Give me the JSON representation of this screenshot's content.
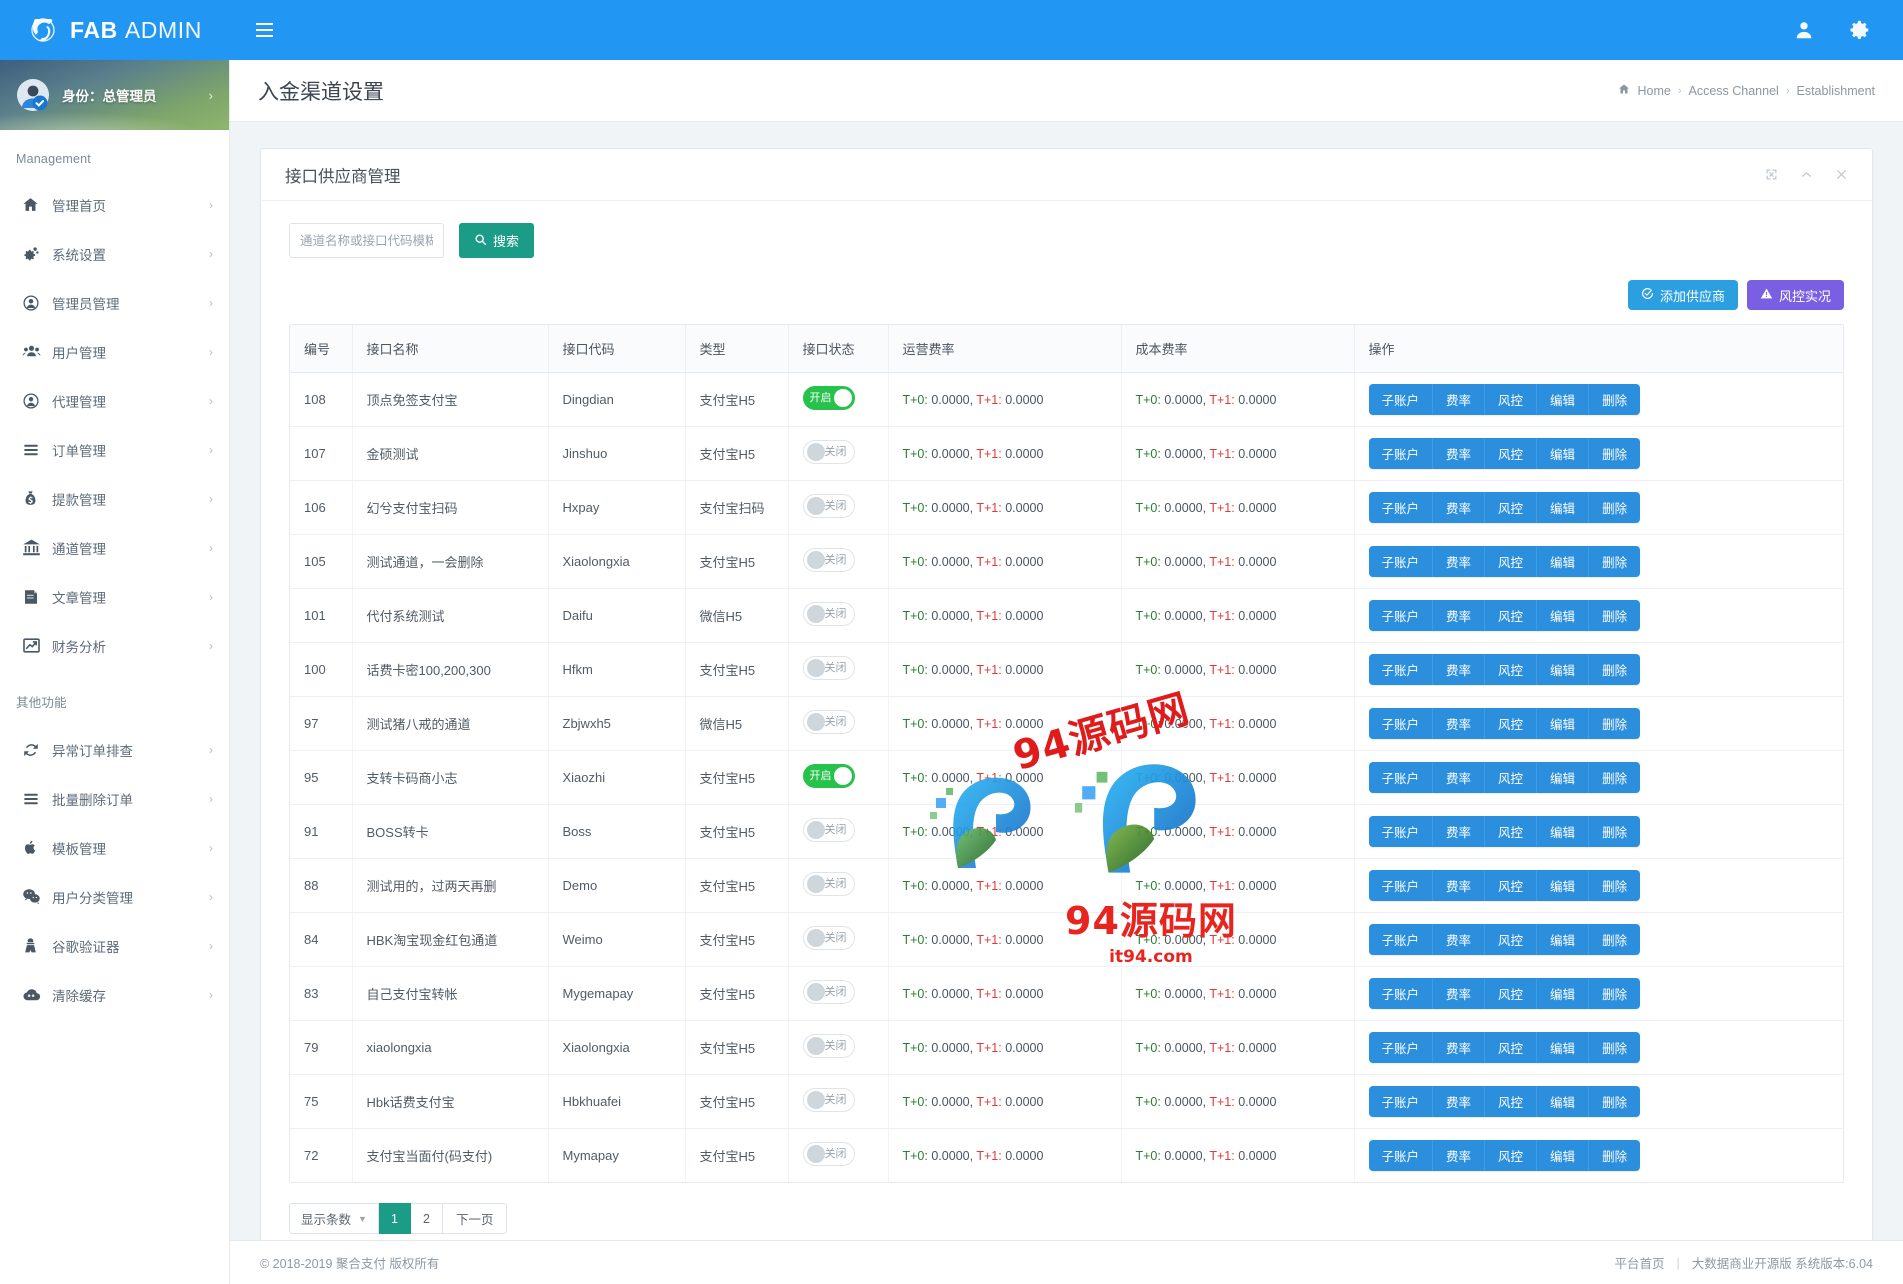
{
  "brand": {
    "name_bold": "FAB",
    "name_light": "ADMIN"
  },
  "topbar": {
    "menu_toggle": "menu-toggle",
    "user_icon": "user-icon",
    "settings_icon": "gear-icon"
  },
  "sidebar": {
    "profile": {
      "label": "身份：总管理员"
    },
    "section_management": "Management",
    "section_other": "其他功能",
    "items": [
      {
        "label": "管理首页",
        "icon": "home-icon"
      },
      {
        "label": "系统设置",
        "icon": "gears-icon"
      },
      {
        "label": "管理员管理",
        "icon": "user-circle-icon"
      },
      {
        "label": "用户管理",
        "icon": "users-icon"
      },
      {
        "label": "代理管理",
        "icon": "user-circle-o-icon"
      },
      {
        "label": "订单管理",
        "icon": "list-icon"
      },
      {
        "label": "提款管理",
        "icon": "money-bag-icon"
      },
      {
        "label": "通道管理",
        "icon": "bank-icon"
      },
      {
        "label": "文章管理",
        "icon": "book-icon"
      },
      {
        "label": "财务分析",
        "icon": "chart-line-icon"
      }
    ],
    "items_other": [
      {
        "label": "异常订单排查",
        "icon": "refresh-icon"
      },
      {
        "label": "批量删除订单",
        "icon": "list-icon"
      },
      {
        "label": "模板管理",
        "icon": "apple-icon"
      },
      {
        "label": "用户分类管理",
        "icon": "wechat-icon"
      },
      {
        "label": "谷歌验证器",
        "icon": "user-secret-icon"
      },
      {
        "label": "清除缓存",
        "icon": "cloud-icon"
      }
    ]
  },
  "page": {
    "title": "入金渠道设置",
    "breadcrumb": [
      {
        "label": "Home",
        "icon": "home-icon"
      },
      {
        "label": "Access Channel"
      },
      {
        "label": "Establishment"
      }
    ],
    "crumb_sep": "›"
  },
  "card": {
    "title": "接口供应商管理",
    "tools": [
      {
        "name": "expand-icon",
        "glyph": "⤢"
      },
      {
        "name": "collapse-icon",
        "glyph": "⌃"
      },
      {
        "name": "close-icon",
        "glyph": "✕"
      }
    ]
  },
  "search": {
    "placeholder": "通道名称或接口代码模糊搜索",
    "value": "",
    "button_label": "搜索",
    "button_icon": "search-icon"
  },
  "actions": {
    "add_label": "添加供应商",
    "add_icon": "check-circle-icon",
    "risk_label": "风控实况",
    "risk_icon": "warning-icon"
  },
  "table": {
    "columns": [
      "编号",
      "接口名称",
      "接口代码",
      "类型",
      "接口状态",
      "运营费率",
      "成本费率",
      "操作"
    ],
    "status_on_label": "开启",
    "status_off_label": "关闭",
    "rate_t0_label": "T+0:",
    "rate_t1_label": "T+1:",
    "rate_value": "0.0000",
    "row_actions": [
      "子账户",
      "费率",
      "风控",
      "编辑",
      "删除"
    ],
    "rows": [
      {
        "id": "108",
        "name": "顶点免签支付宝",
        "code": "Dingdian",
        "type": "支付宝H5",
        "status": "on",
        "fee_t0": "0.0000",
        "fee_t1": "0.0000",
        "cost_t0": "0.0000",
        "cost_t1": "0.0000"
      },
      {
        "id": "107",
        "name": "金硕测试",
        "code": "Jinshuo",
        "type": "支付宝H5",
        "status": "off",
        "fee_t0": "0.0000",
        "fee_t1": "0.0000",
        "cost_t0": "0.0000",
        "cost_t1": "0.0000"
      },
      {
        "id": "106",
        "name": "幻兮支付宝扫码",
        "code": "Hxpay",
        "type": "支付宝扫码",
        "status": "off",
        "fee_t0": "0.0000",
        "fee_t1": "0.0000",
        "cost_t0": "0.0000",
        "cost_t1": "0.0000"
      },
      {
        "id": "105",
        "name": "测试通道，一会删除",
        "code": "Xiaolongxia",
        "type": "支付宝H5",
        "status": "off",
        "fee_t0": "0.0000",
        "fee_t1": "0.0000",
        "cost_t0": "0.0000",
        "cost_t1": "0.0000"
      },
      {
        "id": "101",
        "name": "代付系统测试",
        "code": "Daifu",
        "type": "微信H5",
        "status": "off",
        "fee_t0": "0.0000",
        "fee_t1": "0.0000",
        "cost_t0": "0.0000",
        "cost_t1": "0.0000"
      },
      {
        "id": "100",
        "name": "话费卡密100,200,300",
        "code": "Hfkm",
        "type": "支付宝H5",
        "status": "off",
        "fee_t0": "0.0000",
        "fee_t1": "0.0000",
        "cost_t0": "0.0000",
        "cost_t1": "0.0000"
      },
      {
        "id": "97",
        "name": "测试猪八戒的通道",
        "code": "Zbjwxh5",
        "type": "微信H5",
        "status": "off",
        "fee_t0": "0.0000",
        "fee_t1": "0.0000",
        "cost_t0": "0.0000",
        "cost_t1": "0.0000"
      },
      {
        "id": "95",
        "name": "支转卡码商小志",
        "code": "Xiaozhi",
        "type": "支付宝H5",
        "status": "on",
        "fee_t0": "0.0000",
        "fee_t1": "0.0000",
        "cost_t0": "0.0000",
        "cost_t1": "0.0000"
      },
      {
        "id": "91",
        "name": "BOSS转卡",
        "code": "Boss",
        "type": "支付宝H5",
        "status": "off",
        "fee_t0": "0.0000",
        "fee_t1": "0.0000",
        "cost_t0": "0.0000",
        "cost_t1": "0.0000"
      },
      {
        "id": "88",
        "name": "测试用的，过两天再删",
        "code": "Demo",
        "type": "支付宝H5",
        "status": "off",
        "fee_t0": "0.0000",
        "fee_t1": "0.0000",
        "cost_t0": "0.0000",
        "cost_t1": "0.0000"
      },
      {
        "id": "84",
        "name": "HBK淘宝现金红包通道",
        "code": "Weimo",
        "type": "支付宝H5",
        "status": "off",
        "fee_t0": "0.0000",
        "fee_t1": "0.0000",
        "cost_t0": "0.0000",
        "cost_t1": "0.0000"
      },
      {
        "id": "83",
        "name": "自己支付宝转帐",
        "code": "Mygemapay",
        "type": "支付宝H5",
        "status": "off",
        "fee_t0": "0.0000",
        "fee_t1": "0.0000",
        "cost_t0": "0.0000",
        "cost_t1": "0.0000"
      },
      {
        "id": "79",
        "name": "xiaolongxia",
        "code": "Xiaolongxia",
        "type": "支付宝H5",
        "status": "off",
        "fee_t0": "0.0000",
        "fee_t1": "0.0000",
        "cost_t0": "0.0000",
        "cost_t1": "0.0000"
      },
      {
        "id": "75",
        "name": "Hbk话费支付宝",
        "code": "Hbkhuafei",
        "type": "支付宝H5",
        "status": "off",
        "fee_t0": "0.0000",
        "fee_t1": "0.0000",
        "cost_t0": "0.0000",
        "cost_t1": "0.0000"
      },
      {
        "id": "72",
        "name": "支付宝当面付(码支付)",
        "code": "Mymapay",
        "type": "支付宝H5",
        "status": "off",
        "fee_t0": "0.0000",
        "fee_t1": "0.0000",
        "cost_t0": "0.0000",
        "cost_t1": "0.0000"
      }
    ]
  },
  "pagination": {
    "size_label": "显示条数",
    "pages": [
      "1",
      "2"
    ],
    "active_page": "1",
    "next_label": "下一页"
  },
  "footer": {
    "copyright": "© 2018-2019 聚合支付 版权所有",
    "home_link": "平台首页",
    "version": "大数据商业开源版 系统版本:6.04"
  },
  "watermark": {
    "top_text": "94源码网",
    "bottom_text": "94源码网",
    "bottom_url": "it94.com"
  }
}
